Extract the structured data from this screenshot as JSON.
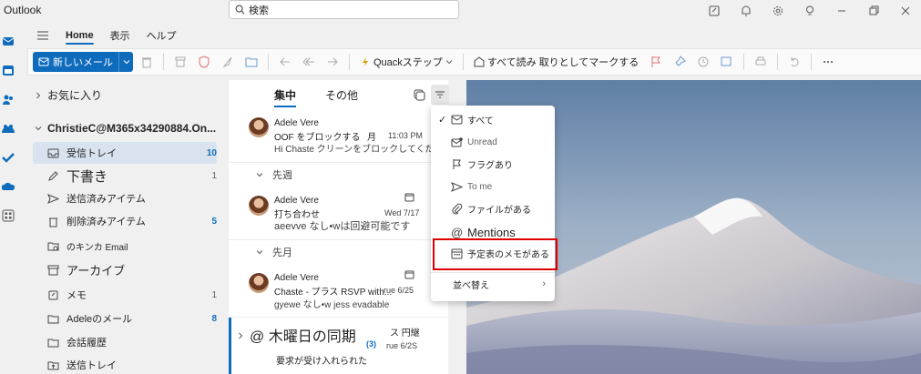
{
  "app": {
    "name": "Outlook"
  },
  "search": {
    "placeholder": "検索"
  },
  "ribbon": {
    "tabs": [
      "Home",
      "表示",
      "ヘルプ"
    ],
    "new_mail": "新しいメール",
    "quick_steps": "Quackステップ",
    "mark_all_read": "すべて読み 取りとしてマークする"
  },
  "folders": {
    "favorites": "お気に入り",
    "account": "ChristieC@M365x34290884.On...",
    "items": [
      {
        "label": "受信トレイ",
        "count": "10"
      },
      {
        "label": "下書き",
        "count": "1"
      },
      {
        "label": "送信済みアイテム",
        "count": ""
      },
      {
        "label": "削除済みアイテム",
        "count": "5"
      },
      {
        "label": "のキンカ Email",
        "count": ""
      },
      {
        "label": "アーカイブ",
        "count": ""
      },
      {
        "label": "メモ",
        "count": "1"
      },
      {
        "label": "Adeleのメール",
        "count": "8"
      },
      {
        "label": "会話履歴",
        "count": ""
      },
      {
        "label": "送信トレイ",
        "count": ""
      }
    ]
  },
  "message_list": {
    "focused_tab": "集中",
    "other_tab": "その他",
    "messages": [
      {
        "sender": "Adele Vere",
        "subject": "OOF をブロックする",
        "subject_extra": "月",
        "date": "11:03 PM",
        "preview": "Hi Chaste クリーンをブロックしてください"
      },
      {
        "sender": "Adele Vere",
        "subject": "打ち合わせ",
        "date": "Wed 7/17",
        "preview": "aeevve なし•wは回避可能です"
      },
      {
        "sender": "Adele Vere",
        "subject": "Chaste - プラス RSVP with...",
        "date": "rue 6/25",
        "preview": "gyewe なし•w jess evadable"
      },
      {
        "sender": "@ 木曜日の同期",
        "subject_extra": "ス 円継",
        "count": "(3)",
        "date": "rue 6/2S",
        "preview": "要求が受け入れられた"
      }
    ],
    "groups": [
      "先週",
      "先月"
    ]
  },
  "filter_menu": {
    "items": [
      {
        "label": "すべて",
        "checked": true
      },
      {
        "label": "Unread"
      },
      {
        "label": "フラグあり"
      },
      {
        "label": "To me"
      },
      {
        "label": "ファイルがある"
      },
      {
        "label": "Mentions"
      },
      {
        "label": "予定表のメモがある"
      }
    ],
    "sort": "並べ替え"
  },
  "colors": {
    "accent": "#0f6cbd",
    "highlight": "#e00000"
  }
}
